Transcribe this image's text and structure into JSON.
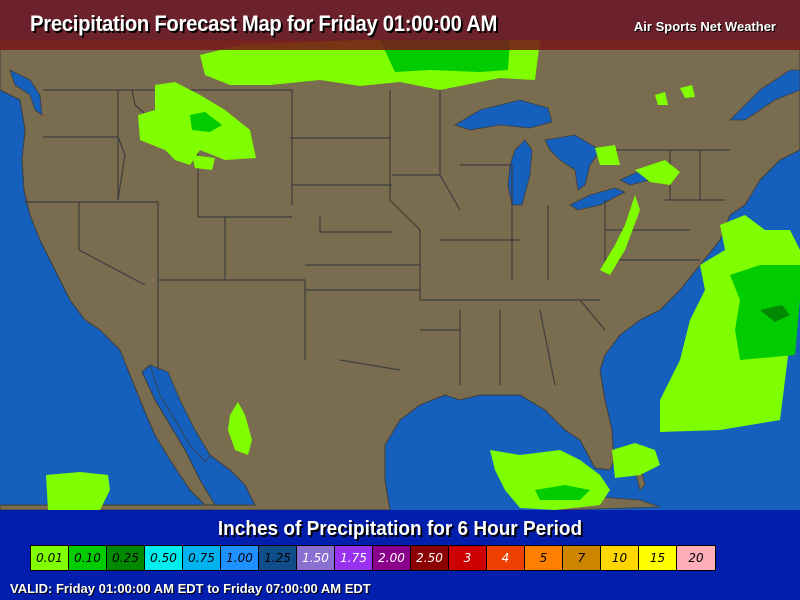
{
  "header": {
    "title": "Precipitation Forecast Map for Friday 01:00:00 AM",
    "brand": "Air Sports Net Weather"
  },
  "colors": {
    "ocean": "#1560bd",
    "land": "#7a6c4e",
    "border": "#3e3e3e",
    "header_bg": "#781919",
    "footer_bg": "#0014aa"
  },
  "legend": {
    "title": "Inches of Precipitation for 6 Hour Period",
    "items": [
      {
        "label": "0.01",
        "color": "#7fff00",
        "text": "#000000"
      },
      {
        "label": "0.10",
        "color": "#00cc00",
        "text": "#000000"
      },
      {
        "label": "0.25",
        "color": "#008800",
        "text": "#000000"
      },
      {
        "label": "0.50",
        "color": "#00eeee",
        "text": "#000000"
      },
      {
        "label": "0.75",
        "color": "#00b2ee",
        "text": "#000000"
      },
      {
        "label": "1.00",
        "color": "#1e90ff",
        "text": "#000000"
      },
      {
        "label": "1.25",
        "color": "#104e8b",
        "text": "#000000"
      },
      {
        "label": "1.50",
        "color": "#8a6fd0",
        "text": "#ffffff"
      },
      {
        "label": "1.75",
        "color": "#9932ee",
        "text": "#ffffff"
      },
      {
        "label": "2.00",
        "color": "#8b008b",
        "text": "#ffffff"
      },
      {
        "label": "2.50",
        "color": "#8b0000",
        "text": "#ffffff"
      },
      {
        "label": "3",
        "color": "#cc0000",
        "text": "#ffffff"
      },
      {
        "label": "4",
        "color": "#ee4000",
        "text": "#ffffff"
      },
      {
        "label": "5",
        "color": "#ff8000",
        "text": "#000000"
      },
      {
        "label": "7",
        "color": "#cd8500",
        "text": "#000000"
      },
      {
        "label": "10",
        "color": "#ffd700",
        "text": "#000000"
      },
      {
        "label": "15",
        "color": "#ffff00",
        "text": "#000000"
      },
      {
        "label": "20",
        "color": "#ffaeb9",
        "text": "#000000"
      }
    ]
  },
  "valid": "VALID: Friday 01:00:00 AM EDT to Friday 07:00:00 AM EDT"
}
